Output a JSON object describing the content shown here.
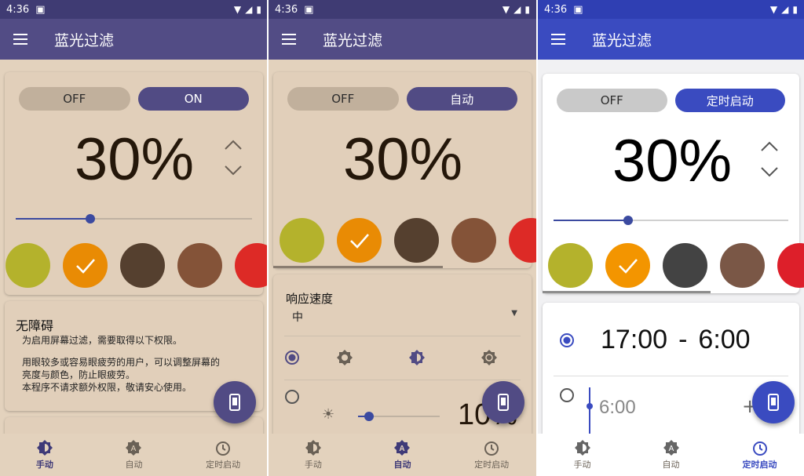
{
  "status_time": "4:36",
  "app_title": "蓝光过滤",
  "toggle_off": "OFF",
  "panels": [
    {
      "toggle_on": "ON",
      "percent": "30%",
      "active_tab": 0
    },
    {
      "toggle_on": "自动",
      "percent": "30%",
      "active_tab": 1
    },
    {
      "toggle_on": "定时启动",
      "percent": "30%",
      "active_tab": 2
    }
  ],
  "brightness_level": 0.3,
  "swatch_colors": [
    "#b4b22c",
    "#e98b04",
    "#55402f",
    "#845338",
    "#dd2a26"
  ],
  "swatch_colors_timer": [
    "#b4b22c",
    "#f39500",
    "#434343",
    "#7a5746",
    "#dd1f2a"
  ],
  "selected_swatch": 1,
  "accessibility": {
    "title": "无障碍",
    "line1": "为启用屏幕过滤，需要取得以下权限。",
    "line2": "用眼较多或容易眼疲劳的用户，可以调整屏幕的",
    "line3": "亮度与颜色，防止眼疲劳。",
    "line4": "本程序不请求额外权限，敬请安心使用。",
    "partial": "..."
  },
  "response": {
    "title": "响应速度",
    "value": "中",
    "percent": "10%"
  },
  "timer": {
    "start": "17:00",
    "dash": "-",
    "end": "6:00",
    "next": "6:00",
    "plus": "+"
  },
  "nav": [
    "手动",
    "自动",
    "定时启动"
  ],
  "colors": {
    "purple_bar": "#524c85",
    "blue_bar": "#3a4bc0",
    "beige": "#e3d2bd"
  }
}
